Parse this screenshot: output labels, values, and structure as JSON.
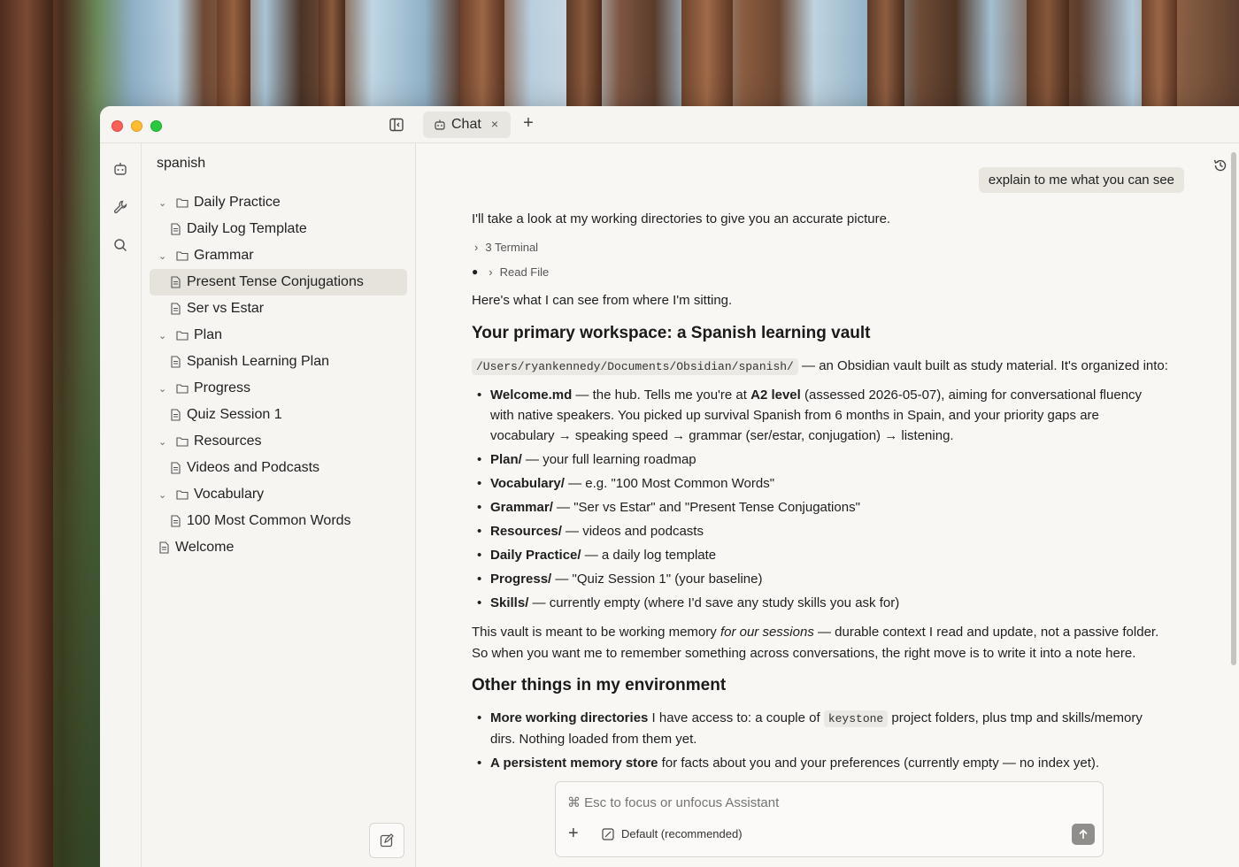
{
  "window": {
    "tab_label": "Chat",
    "tab_close": "×",
    "new_tab": "+"
  },
  "sidebar": {
    "vault_name": "spanish",
    "tree": [
      {
        "label": "Daily Practice",
        "type": "folder"
      },
      {
        "label": "Daily Log Template",
        "type": "file"
      },
      {
        "label": "Grammar",
        "type": "folder"
      },
      {
        "label": "Present Tense Conjugations",
        "type": "file",
        "selected": true
      },
      {
        "label": "Ser vs Estar",
        "type": "file"
      },
      {
        "label": "Plan",
        "type": "folder"
      },
      {
        "label": "Spanish Learning Plan",
        "type": "file"
      },
      {
        "label": "Progress",
        "type": "folder"
      },
      {
        "label": "Quiz Session 1",
        "type": "file"
      },
      {
        "label": "Resources",
        "type": "folder"
      },
      {
        "label": "Videos and Podcasts",
        "type": "file"
      },
      {
        "label": "Vocabulary",
        "type": "folder"
      },
      {
        "label": "100 Most Common Words",
        "type": "file"
      },
      {
        "label": "Welcome",
        "type": "file"
      }
    ]
  },
  "chat": {
    "user_message": "explain to me what you can see",
    "intro": "I'll take a look at my working directories to give you an accurate picture.",
    "tool_terminal": "3 Terminal",
    "tool_read": "Read File",
    "lead": "Here's what I can see from where I'm sitting.",
    "h1": "Your primary workspace: a Spanish learning vault",
    "path": "/Users/ryankennedy/Documents/Obsidian/spanish/",
    "path_desc": " — an Obsidian vault built as study material. It's organized into:",
    "b1_name": "Welcome.md",
    "b1_a": " — the hub. Tells me you're at ",
    "b1_level": "A2 level",
    "b1_b": " (assessed 2026-05-07), aiming for conversational fluency with native speakers. You picked up survival Spanish from 6 months in Spain, and your priority gaps are vocabulary → speaking speed → grammar (ser/estar, conjugation) → listening.",
    "b2_name": "Plan/",
    "b2_text": " — your full learning roadmap",
    "b3_name": "Vocabulary/",
    "b3_text": " — e.g. \"100 Most Common Words\"",
    "b4_name": "Grammar/",
    "b4_text": " — \"Ser vs Estar\" and \"Present Tense Conjugations\"",
    "b5_name": "Resources/",
    "b5_text": " — videos and podcasts",
    "b6_name": "Daily Practice/",
    "b6_text": " — a daily log template",
    "b7_name": "Progress/",
    "b7_text": " — \"Quiz Session 1\" (your baseline)",
    "b8_name": "Skills/",
    "b8_text": " — currently empty (where I'd save any study skills you ask for)",
    "memo_a": "This vault is meant to be working memory ",
    "memo_i": "for our sessions",
    "memo_b": " — durable context I read and update, not a passive folder.",
    "memo_c": "So when you want me to remember something across conversations, the right move is to write it into a note here.",
    "h2": "Other things in my environment",
    "e1_name": "More working directories",
    "e1_a": " I have access to: a couple of ",
    "e1_code": "keystone",
    "e1_b": " project folders, plus tmp and skills/memory dirs. Nothing loaded from them yet.",
    "e2_name": "A persistent memory store",
    "e2_text": " for facts about you and your preferences (currently empty — no index yet)."
  },
  "composer": {
    "placeholder": "⌘ Esc to focus or unfocus Assistant",
    "mode": "Default (recommended)"
  }
}
